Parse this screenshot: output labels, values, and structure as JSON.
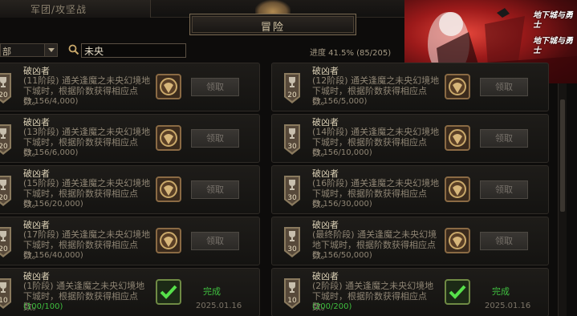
{
  "top_tab": {
    "label": "军团/攻坚战"
  },
  "title": "冒险",
  "filter": {
    "value": "部"
  },
  "search": {
    "value": "未央",
    "icon": "search-icon"
  },
  "progress": {
    "text": "进度 41.5% (85/205)",
    "fraction": 0.415
  },
  "banner": {
    "brand_line1": "地下城与勇士",
    "brand_line2": "地下城与勇士"
  },
  "cards": [
    {
      "name": "破凶者",
      "desc": "(11阶段) 通关逢魔之未央幻境地下城时，根据阶数获得相应点数。",
      "count": "(3,156/4,000)",
      "badge": "20",
      "state": "locked",
      "button": "领取"
    },
    {
      "name": "破凶者",
      "desc": "(12阶段) 通关逢魔之未央幻境地下城时，根据阶数获得相应点数。",
      "count": "(3,156/5,000)",
      "badge": "20",
      "state": "locked",
      "button": "领取"
    },
    {
      "name": "破凶者",
      "desc": "(13阶段) 通关逢魔之未央幻境地下城时，根据阶数获得相应点数。",
      "count": "(3,156/6,000)",
      "badge": "20",
      "state": "locked",
      "button": "领取"
    },
    {
      "name": "破凶者",
      "desc": "(14阶段) 通关逢魔之未央幻境地下城时，根据阶数获得相应点数。",
      "count": "(3,156/10,000)",
      "badge": "30",
      "state": "locked",
      "button": "领取"
    },
    {
      "name": "破凶者",
      "desc": "(15阶段) 通关逢魔之未央幻境地下城时，根据阶数获得相应点数。",
      "count": "(3,156/20,000)",
      "badge": "20",
      "state": "locked",
      "button": "领取"
    },
    {
      "name": "破凶者",
      "desc": "(16阶段) 通关逢魔之未央幻境地下城时，根据阶数获得相应点数。",
      "count": "(3,156/30,000)",
      "badge": "30",
      "state": "locked",
      "button": "领取"
    },
    {
      "name": "破凶者",
      "desc": "(17阶段) 通关逢魔之未央幻境地下城时，根据阶数获得相应点数。",
      "count": "(3,156/40,000)",
      "badge": "20",
      "state": "locked",
      "button": "领取"
    },
    {
      "name": "破凶者",
      "desc": "(最终阶段) 通关逢魔之未央幻境地下城时，根据阶数获得相应点数。",
      "count": "(3,156/50,000)",
      "badge": "30",
      "state": "locked",
      "button": "领取"
    },
    {
      "name": "破凶者",
      "desc": "(1阶段) 通关逢魔之未央幻境地下城时，根据阶数获得相应点数。",
      "count": "(100/100)",
      "badge": "10",
      "state": "done",
      "status": "完成",
      "date": "2025.01.16"
    },
    {
      "name": "破凶者",
      "desc": "(2阶段) 通关逢魔之未央幻境地下城时，根据阶数获得相应点数。",
      "count": "(200/200)",
      "badge": "10",
      "state": "done",
      "status": "完成",
      "date": "2025.01.16"
    }
  ],
  "colors": {
    "accent_gold": "#c9a86a",
    "done_green": "#3fbf3f",
    "banner_red": "#9c1a1a"
  }
}
